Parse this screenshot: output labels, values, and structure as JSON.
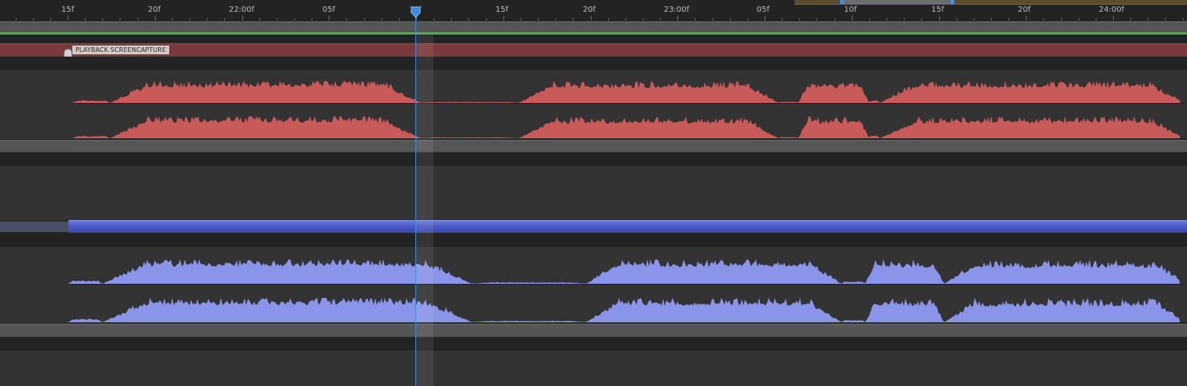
{
  "ruler": {
    "ticks": [
      {
        "label": "15f"
      },
      {
        "label": "20f"
      },
      {
        "label": "22:00f"
      },
      {
        "label": "05f"
      },
      {
        "label": "10f"
      },
      {
        "label": "15f"
      },
      {
        "label": "20f"
      },
      {
        "label": "23:00f"
      },
      {
        "label": "05f"
      },
      {
        "label": "10f"
      },
      {
        "label": "15f"
      },
      {
        "label": "20f"
      },
      {
        "label": "24:00f"
      }
    ]
  },
  "layers": {
    "screencapture_label": "PLAYBACK SCREENCAPTURE"
  },
  "colors": {
    "accent": "#3b8ae0",
    "audio_red": "#c85a5a",
    "audio_blue": "#8a94e8",
    "green_bar": "#3fb83f"
  }
}
